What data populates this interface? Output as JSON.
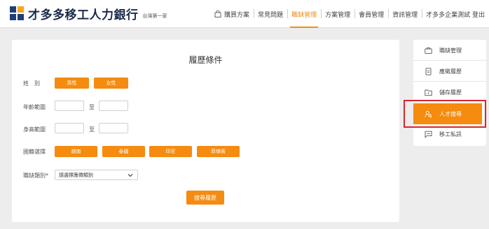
{
  "brand": {
    "name": "才多多移工人力銀行",
    "tagline": "台灣第一家"
  },
  "nav": {
    "items": [
      {
        "label": "購買方案"
      },
      {
        "label": "常見問題"
      },
      {
        "label": "職缺管理",
        "active": true
      },
      {
        "label": "方案管理"
      },
      {
        "label": "會員管理"
      },
      {
        "label": "資訊管理"
      },
      {
        "label": "才多多企業測試 登出"
      }
    ]
  },
  "form": {
    "title": "履歷條件",
    "gender_label": "姓　別",
    "gender_options": [
      "男性",
      "女性"
    ],
    "age_label": "年齡範圍",
    "height_label": "身高範圍",
    "range_to": "至",
    "nationality_label": "國籍選擇",
    "nationality_options": [
      "越南",
      "泰國",
      "印尼",
      "菲律賓"
    ],
    "job_label": "職缺類別*",
    "job_select": "請選擇應徵類別",
    "search_button": "搜尋履歷"
  },
  "sidebar": {
    "items": [
      {
        "label": "職缺管理",
        "icon": "briefcase-icon"
      },
      {
        "label": "應徵履歷",
        "icon": "document-icon"
      },
      {
        "label": "儲存履歷",
        "icon": "folder-icon"
      },
      {
        "label": "人才搜尋",
        "icon": "user-search-icon",
        "active": true
      },
      {
        "label": "移工私訊",
        "icon": "chat-icon"
      }
    ]
  },
  "colors": {
    "accent": "#f58b0f",
    "highlight_border": "#d7262c",
    "brand_navy": "#1d3f7a"
  }
}
